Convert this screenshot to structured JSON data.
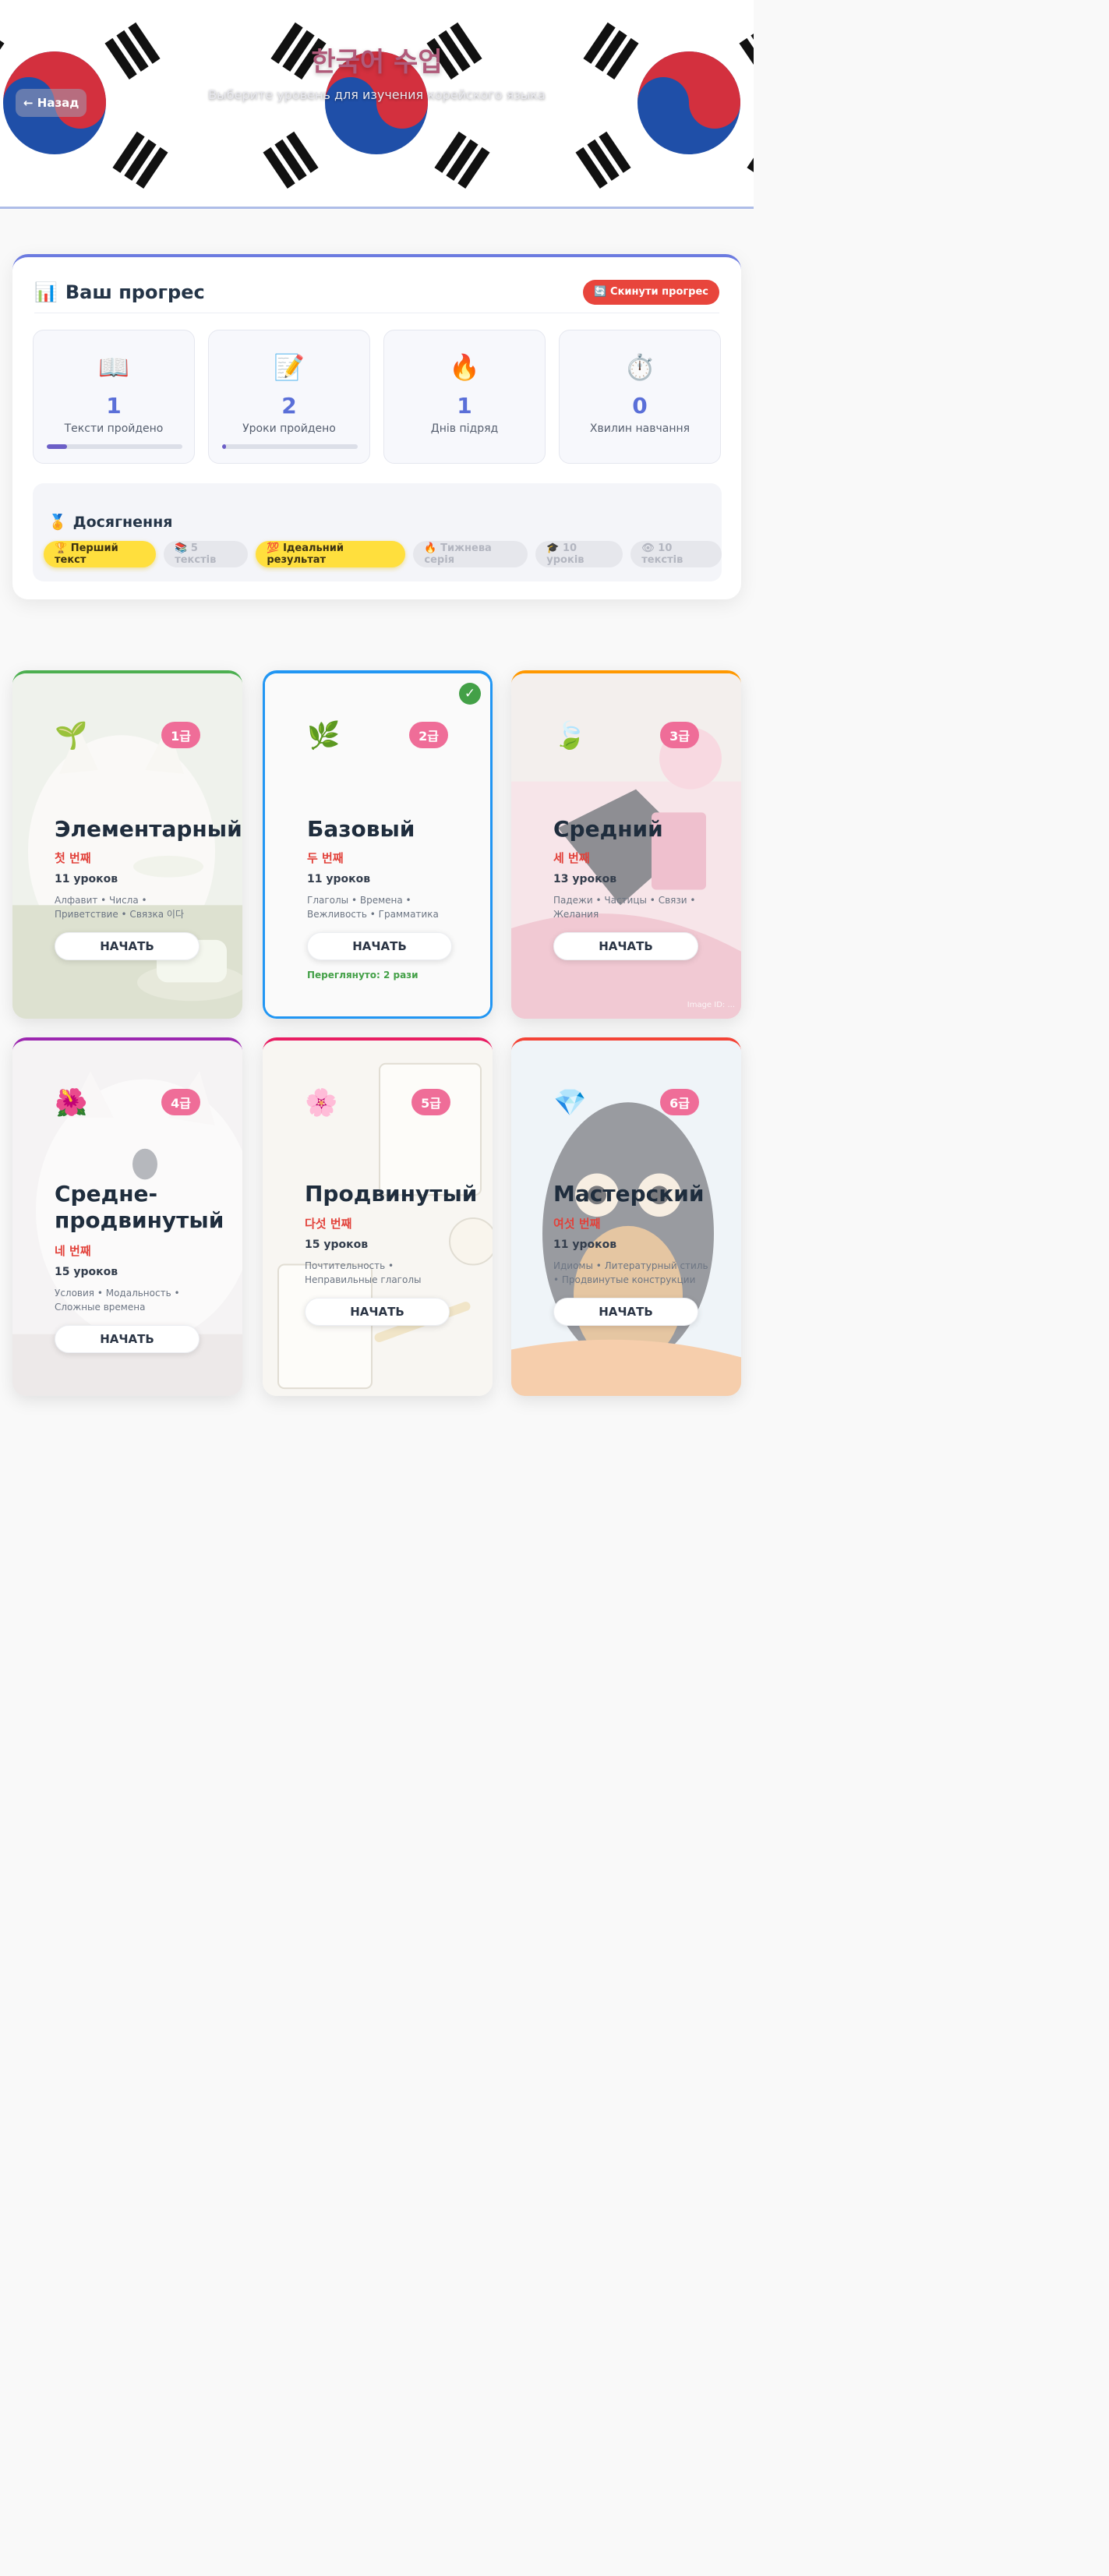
{
  "header": {
    "back_label": "← Назад",
    "title": "한국어 수업",
    "subtitle": "Выберите уровень для изучения корейского языка"
  },
  "progress": {
    "title": "Ваш прогрес",
    "title_icon": "📊",
    "reset_label": "🔄 Скинути прогрес",
    "stats": [
      {
        "icon": "📖",
        "value": "1",
        "label": "Тексти пройдено",
        "fill": 0.15
      },
      {
        "icon": "📝",
        "value": "2",
        "label": "Уроки пройдено",
        "fill": 0.03
      },
      {
        "icon": "🔥",
        "value": "1",
        "label": "Днів підряд"
      },
      {
        "icon": "⏱️",
        "value": "0",
        "label": "Хвилин навчання"
      }
    ],
    "achievements": {
      "title": "Досягнення",
      "title_icon": "🏅",
      "badges": [
        {
          "label": "🏆 Перший текст",
          "earned": true
        },
        {
          "label": "📚 5 текстів",
          "earned": false
        },
        {
          "label": "💯 Ідеальний результат",
          "earned": true
        },
        {
          "label": "🔥 Тижнева серія",
          "earned": false
        },
        {
          "label": "🎓 10 уроків",
          "earned": false
        },
        {
          "label": "👁 10 текстів",
          "earned": false
        }
      ]
    }
  },
  "levels": [
    {
      "icon": "🌱",
      "grade": "1급",
      "title": "Элементарный",
      "korean": "첫 번째",
      "lessons": "11 уроков",
      "topics": "Алфавит • Числа • Приветствие • Связка 이다",
      "button": "НАЧАТЬ",
      "accent": "#4caf50"
    },
    {
      "icon": "🌿",
      "grade": "2급",
      "title": "Базовый",
      "korean": "두 번째",
      "lessons": "11 уроков",
      "topics": "Глаголы • Времена • Вежливость • Грамматика",
      "button": "НАЧАТЬ",
      "accent": "#2196f3",
      "completed": true,
      "extra": "Переглянуто: 2 рази"
    },
    {
      "icon": "🍃",
      "grade": "3급",
      "title": "Средний",
      "korean": "세 번째",
      "lessons": "13 уроков",
      "topics": "Падежи • Частицы • Связи • Желания",
      "button": "НАЧАТЬ",
      "accent": "#ff9800",
      "credit": "Image ID: ..."
    },
    {
      "icon": "🌺",
      "grade": "4급",
      "title": "Средне-продвинутый",
      "korean": "네 번째",
      "lessons": "15 уроков",
      "topics": "Условия • Модальность • Сложные времена",
      "button": "НАЧАТЬ",
      "accent": "#9c27b0"
    },
    {
      "icon": "🌸",
      "grade": "5급",
      "title": "Продвинутый",
      "korean": "다섯 번째",
      "lessons": "15 уроков",
      "topics": "Почтительность • Неправильные глаголы",
      "button": "НАЧАТЬ",
      "accent": "#e91e63"
    },
    {
      "icon": "💎",
      "grade": "6급",
      "title": "Мастерский",
      "korean": "여섯 번째",
      "lessons": "11 уроков",
      "topics": "Идиомы • Литературный стиль • Продвинутые конструкции",
      "button": "НАЧАТЬ",
      "accent": "#f44336"
    }
  ]
}
